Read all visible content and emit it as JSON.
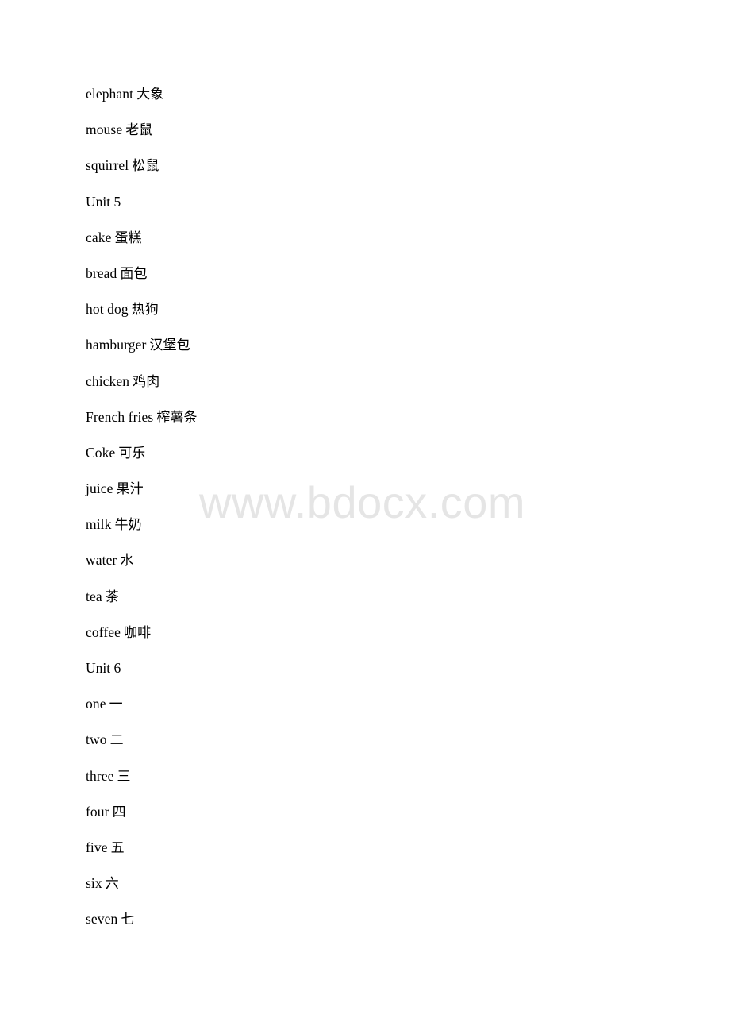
{
  "document": {
    "page_background": "#ffffff",
    "text_color": "#000000",
    "watermark": {
      "text": "www.bdocx.com",
      "color": "#e5e5e5"
    }
  },
  "lines": [
    {
      "type": "vocab",
      "english": "elephant",
      "chinese": "大象"
    },
    {
      "type": "vocab",
      "english": "mouse",
      "chinese": "老鼠"
    },
    {
      "type": "vocab",
      "english": "squirrel",
      "chinese": "松鼠"
    },
    {
      "type": "heading",
      "text": "Unit 5"
    },
    {
      "type": "vocab",
      "english": "cake",
      "chinese": "蛋糕"
    },
    {
      "type": "vocab",
      "english": "bread",
      "chinese": "面包"
    },
    {
      "type": "vocab",
      "english": "hot dog",
      "chinese": "热狗"
    },
    {
      "type": "vocab",
      "english": "hamburger",
      "chinese": "汉堡包"
    },
    {
      "type": "vocab",
      "english": "chicken",
      "chinese": "鸡肉"
    },
    {
      "type": "vocab",
      "english": "French fries",
      "chinese": "榨薯条"
    },
    {
      "type": "vocab",
      "english": "Coke",
      "chinese": "可乐"
    },
    {
      "type": "vocab",
      "english": "juice",
      "chinese": "果汁"
    },
    {
      "type": "vocab",
      "english": "milk",
      "chinese": "牛奶"
    },
    {
      "type": "vocab",
      "english": "water",
      "chinese": "水"
    },
    {
      "type": "vocab",
      "english": "tea",
      "chinese": "茶"
    },
    {
      "type": "vocab",
      "english": "coffee",
      "chinese": "咖啡"
    },
    {
      "type": "heading",
      "text": "Unit 6"
    },
    {
      "type": "vocab",
      "english": "one",
      "chinese": "一"
    },
    {
      "type": "vocab",
      "english": "two",
      "chinese": "二"
    },
    {
      "type": "vocab",
      "english": "three",
      "chinese": "三"
    },
    {
      "type": "vocab",
      "english": "four",
      "chinese": "四"
    },
    {
      "type": "vocab",
      "english": "five",
      "chinese": "五"
    },
    {
      "type": "vocab",
      "english": "six",
      "chinese": "六"
    },
    {
      "type": "vocab",
      "english": "seven",
      "chinese": "七"
    }
  ]
}
